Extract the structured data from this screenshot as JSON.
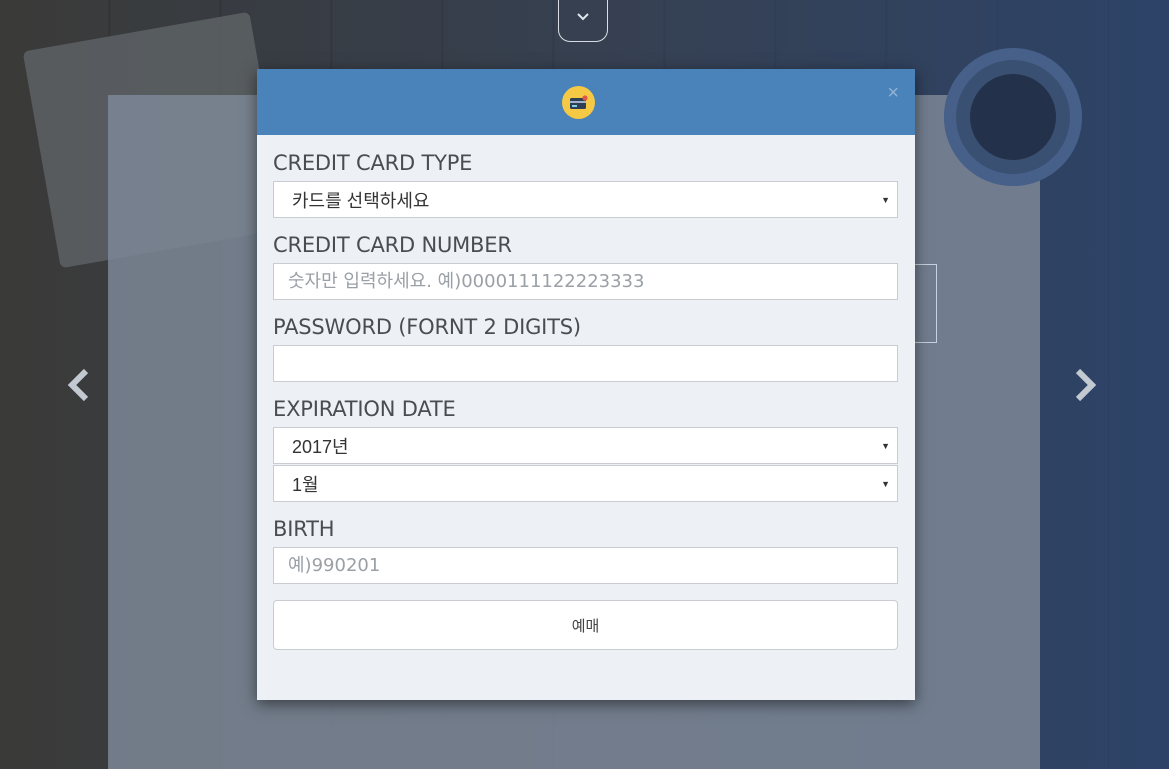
{
  "modal": {
    "close_label": "×",
    "card_type": {
      "label": "CREDIT CARD TYPE",
      "selected": "카드를 선택하세요"
    },
    "card_number": {
      "label": "CREDIT CARD NUMBER",
      "placeholder": "숫자만 입력하세요. 예)0000111122223333"
    },
    "password": {
      "label": "PASSWORD (FORNT 2 DIGITS)",
      "value": ""
    },
    "expiration": {
      "label": "EXPIRATION DATE",
      "year_selected": "2017년",
      "month_selected": "1월"
    },
    "birth": {
      "label": "BIRTH",
      "placeholder": "예)990201"
    },
    "submit_label": "예매"
  },
  "icons": {
    "header_icon": "credit-card-icon",
    "select_caret": "caret-down-icon",
    "prev": "chevron-left-icon",
    "next": "chevron-right-icon",
    "top_toggle": "chevron-down-icon"
  },
  "colors": {
    "header": "#4a82ba",
    "modal_bg": "#edf1f5",
    "icon_bg": "#f6c945"
  }
}
